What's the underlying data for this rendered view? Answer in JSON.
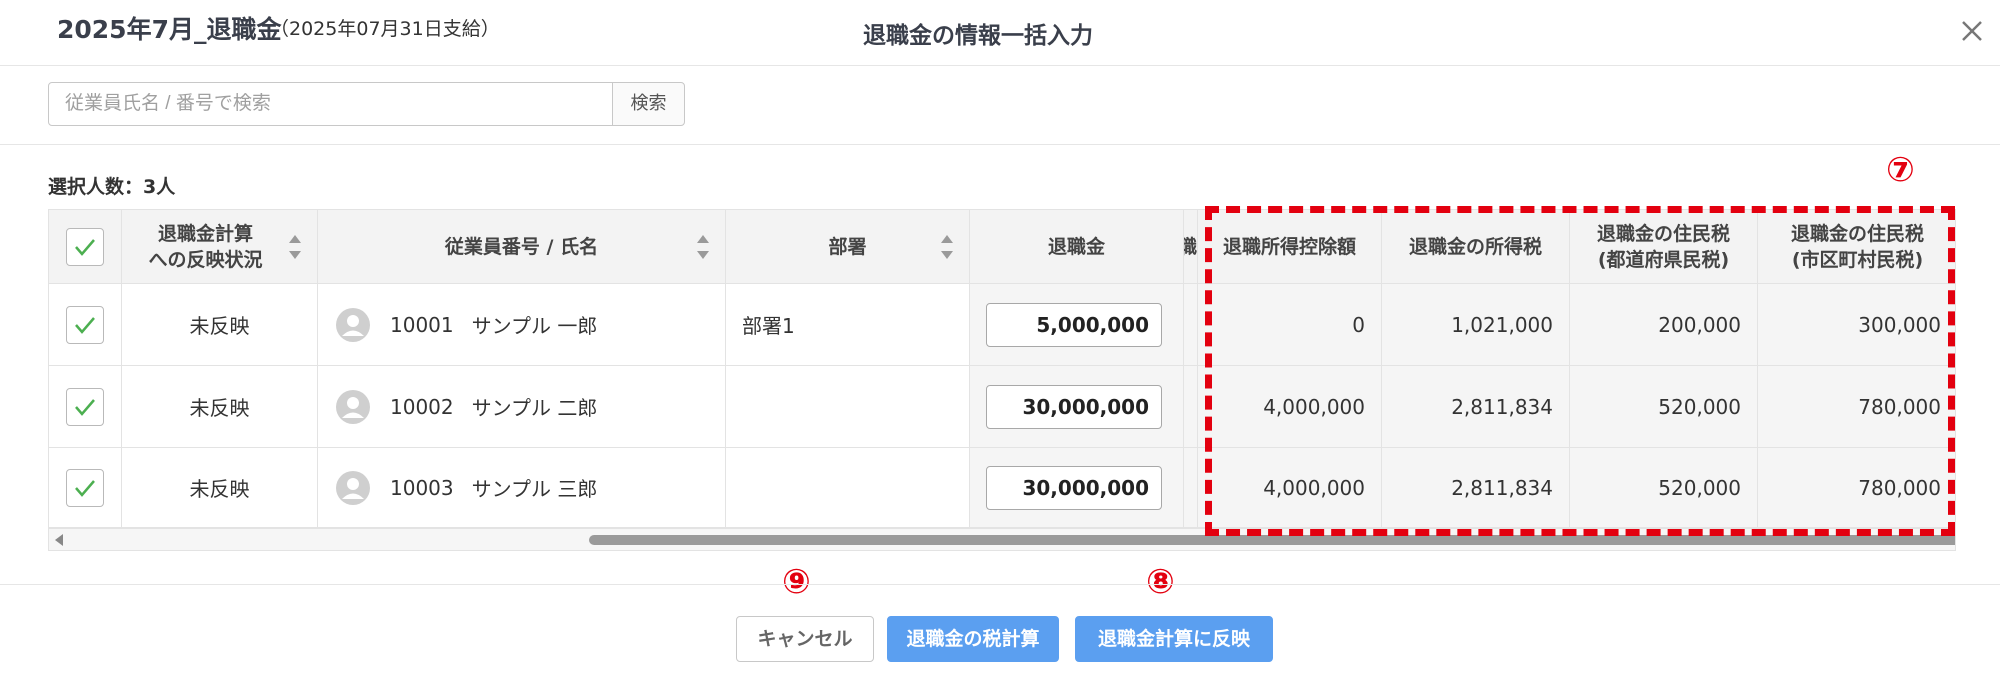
{
  "header": {
    "title": "2025年7月_退職金",
    "subtitle": "（2025年07月31日支給）",
    "dialog_title": "退職金の情報一括入力",
    "close_icon": "close-icon"
  },
  "search": {
    "placeholder": "従業員氏名 / 番号で検索",
    "button_label": "検索"
  },
  "selection": {
    "label": "選択人数：3人"
  },
  "table": {
    "columns": [
      {
        "label": "退職金計算への反映状況",
        "line1": "退職金計算",
        "line2": "への反映状況",
        "sortable": true
      },
      {
        "label": "従業員番号 / 氏名",
        "sortable": true
      },
      {
        "label": "部署",
        "sortable": true
      },
      {
        "label": "退職金",
        "sortable": false
      },
      {
        "label": "職",
        "sortable": false
      },
      {
        "label": "退職所得控除額",
        "sortable": false
      },
      {
        "label": "退職金の所得税",
        "sortable": false
      },
      {
        "label": "退職金の住民税(都道府県民税)",
        "line1": "退職金の住民税",
        "line2": "(都道府県民税)",
        "sortable": false
      },
      {
        "label": "退職金の住民税(市区町村民税)",
        "line1": "退職金の住民税",
        "line2": "(市区町村民税)",
        "sortable": false
      }
    ],
    "rows": [
      {
        "checked": true,
        "status": "未反映",
        "emp_no": "10001",
        "name": "サンプル 一郎",
        "dept": "部署1",
        "retirement_pay": "5,000,000",
        "deduction": "0",
        "income_tax": "1,021,000",
        "pref_tax": "200,000",
        "city_tax": "300,000"
      },
      {
        "checked": true,
        "status": "未反映",
        "emp_no": "10002",
        "name": "サンプル 二郎",
        "dept": "",
        "retirement_pay": "30,000,000",
        "deduction": "4,000,000",
        "income_tax": "2,811,834",
        "pref_tax": "520,000",
        "city_tax": "780,000"
      },
      {
        "checked": true,
        "status": "未反映",
        "emp_no": "10003",
        "name": "サンプル 三郎",
        "dept": "",
        "retirement_pay": "30,000,000",
        "deduction": "4,000,000",
        "income_tax": "2,811,834",
        "pref_tax": "520,000",
        "city_tax": "780,000"
      }
    ]
  },
  "annotations": {
    "marker_7": "⑦",
    "marker_8": "⑧",
    "marker_9": "⑨",
    "highlight_color": "#e3000f"
  },
  "footer": {
    "cancel_label": "キャンセル",
    "tax_calc_label": "退職金の税計算",
    "reflect_label": "退職金計算に反映"
  },
  "colors": {
    "accent_blue": "#5b9ff0",
    "status_red": "#e0251b",
    "check_green": "#4caf50"
  }
}
